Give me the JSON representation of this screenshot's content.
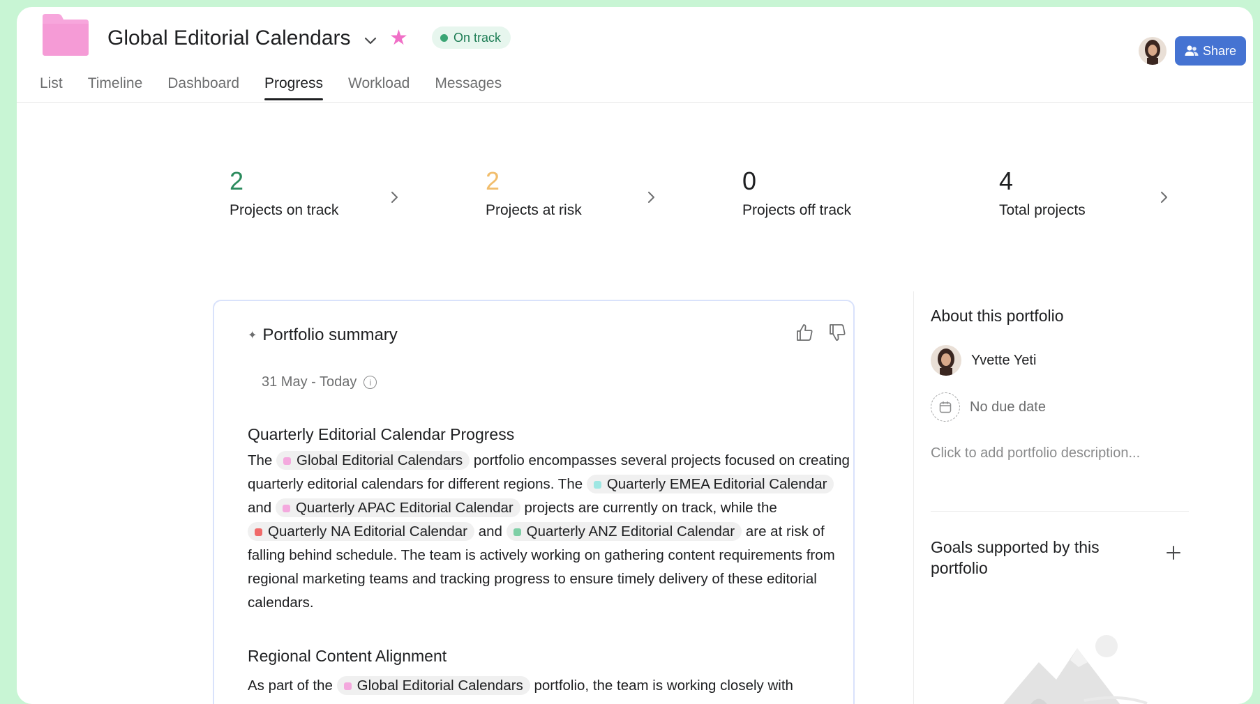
{
  "header": {
    "title": "Global Editorial Calendars",
    "status": "On track",
    "share_label": "Share"
  },
  "tabs": [
    "List",
    "Timeline",
    "Dashboard",
    "Progress",
    "Workload",
    "Messages"
  ],
  "active_tab": "Progress",
  "stats": [
    {
      "value": "2",
      "label": "Projects on track",
      "color": "#2a8a5c"
    },
    {
      "value": "2",
      "label": "Projects at risk",
      "color": "#f1bd6c"
    },
    {
      "value": "0",
      "label": "Projects off track",
      "color": "#1e1f21"
    },
    {
      "value": "4",
      "label": "Total projects",
      "color": "#1e1f21"
    }
  ],
  "summary": {
    "title": "Portfolio summary",
    "date_range": "31 May - Today",
    "section1_heading": "Quarterly Editorial Calendar Progress",
    "p1": {
      "t1": "The",
      "chip_global": "Global Editorial Calendars",
      "t2": "portfolio encompasses several projects focused on creating quarterly editorial calendars for different regions. The",
      "chip_emea": "Quarterly EMEA Editorial Calendar",
      "t3": "and",
      "chip_apac": "Quarterly APAC Editorial Calendar",
      "t4": "projects are currently on track, while the",
      "chip_na": "Quarterly NA Editorial Calendar",
      "t5": "and",
      "chip_anz": "Quarterly ANZ Editorial Calendar",
      "t6": "are at risk of falling behind schedule. The team is actively working on gathering content requirements from regional marketing teams and tracking progress to ensure timely delivery of these editorial calendars."
    },
    "section2_heading": "Regional Content Alignment",
    "p2": {
      "t1": "As part of the",
      "chip_global": "Global Editorial Calendars",
      "t2": "portfolio, the team is working closely with"
    },
    "chip_colors": {
      "global": "#f4a9de",
      "emea": "#9ee7e3",
      "apac": "#f4a9de",
      "na": "#f06a6a",
      "anz": "#7ecfa6"
    }
  },
  "about": {
    "title": "About this portfolio",
    "owner": "Yvette Yeti",
    "due_date": "No due date",
    "description_placeholder": "Click to add portfolio description...",
    "goals_title": "Goals supported by this portfolio"
  },
  "colors": {
    "accent": "#4573d2",
    "on_track": "#2a8a5c",
    "at_risk": "#f1bd6c",
    "folder": "#f7a6dc"
  },
  "icons": {
    "folder": "folder-icon",
    "chevron": "chevron-down-icon",
    "star": "star-icon",
    "share": "people-icon",
    "sparkle": "sparkle-icon",
    "thumbs_up": "thumbs-up-icon",
    "thumbs_down": "thumbs-down-icon",
    "info": "info-icon",
    "calendar": "calendar-icon",
    "plus": "plus-icon"
  }
}
